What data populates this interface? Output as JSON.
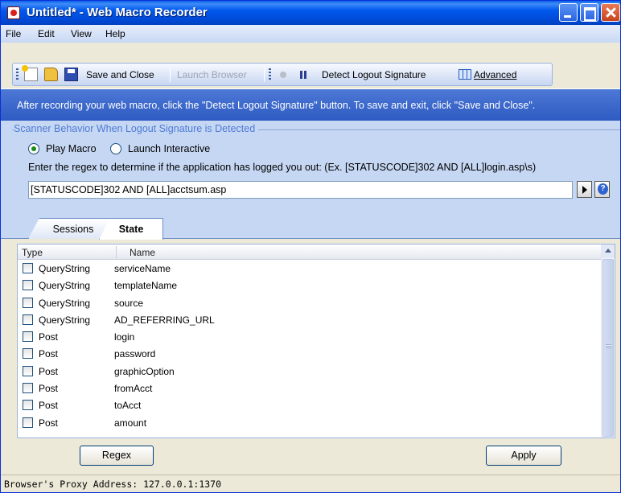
{
  "window": {
    "title": "Untitled* - Web Macro Recorder"
  },
  "menu": {
    "file": "File",
    "edit": "Edit",
    "view": "View",
    "help": "Help"
  },
  "toolbar": {
    "save_close": "Save and Close",
    "launch_browser": "Launch Browser",
    "detect_logout": "Detect Logout Signature",
    "advanced": "Advanced"
  },
  "instruction": "After recording your web macro, click the \"Detect Logout Signature\" button.  To save and exit, click \"Save and Close\".",
  "scanner": {
    "group_title": "Scanner Behavior When Logout Signature is Detected",
    "option_play": "Play Macro",
    "option_launch": "Launch Interactive",
    "selected": "Play Macro",
    "regex_desc": "Enter the regex to determine if the application has logged you out: (Ex. [STATUSCODE]302 AND [ALL]login.asp\\s)",
    "regex_value": "[STATUSCODE]302 AND [ALL]acctsum.asp"
  },
  "tabs": [
    {
      "label": "Sessions",
      "active": false
    },
    {
      "label": "State",
      "active": true
    }
  ],
  "list": {
    "headers": {
      "type": "Type",
      "name": "Name"
    },
    "rows": [
      {
        "type": "QueryString",
        "name": "serviceName",
        "checked": false
      },
      {
        "type": "QueryString",
        "name": "templateName",
        "checked": false
      },
      {
        "type": "QueryString",
        "name": "source",
        "checked": false
      },
      {
        "type": "QueryString",
        "name": "AD_REFERRING_URL",
        "checked": false
      },
      {
        "type": "Post",
        "name": "login",
        "checked": false
      },
      {
        "type": "Post",
        "name": "password",
        "checked": false
      },
      {
        "type": "Post",
        "name": "graphicOption",
        "checked": false
      },
      {
        "type": "Post",
        "name": "fromAcct",
        "checked": false
      },
      {
        "type": "Post",
        "name": "toAcct",
        "checked": false
      },
      {
        "type": "Post",
        "name": "amount",
        "checked": false
      }
    ]
  },
  "buttons": {
    "regex": "Regex",
    "apply": "Apply"
  },
  "status": {
    "proxy": "Browser's Proxy Address: 127.0.0.1:1370"
  }
}
